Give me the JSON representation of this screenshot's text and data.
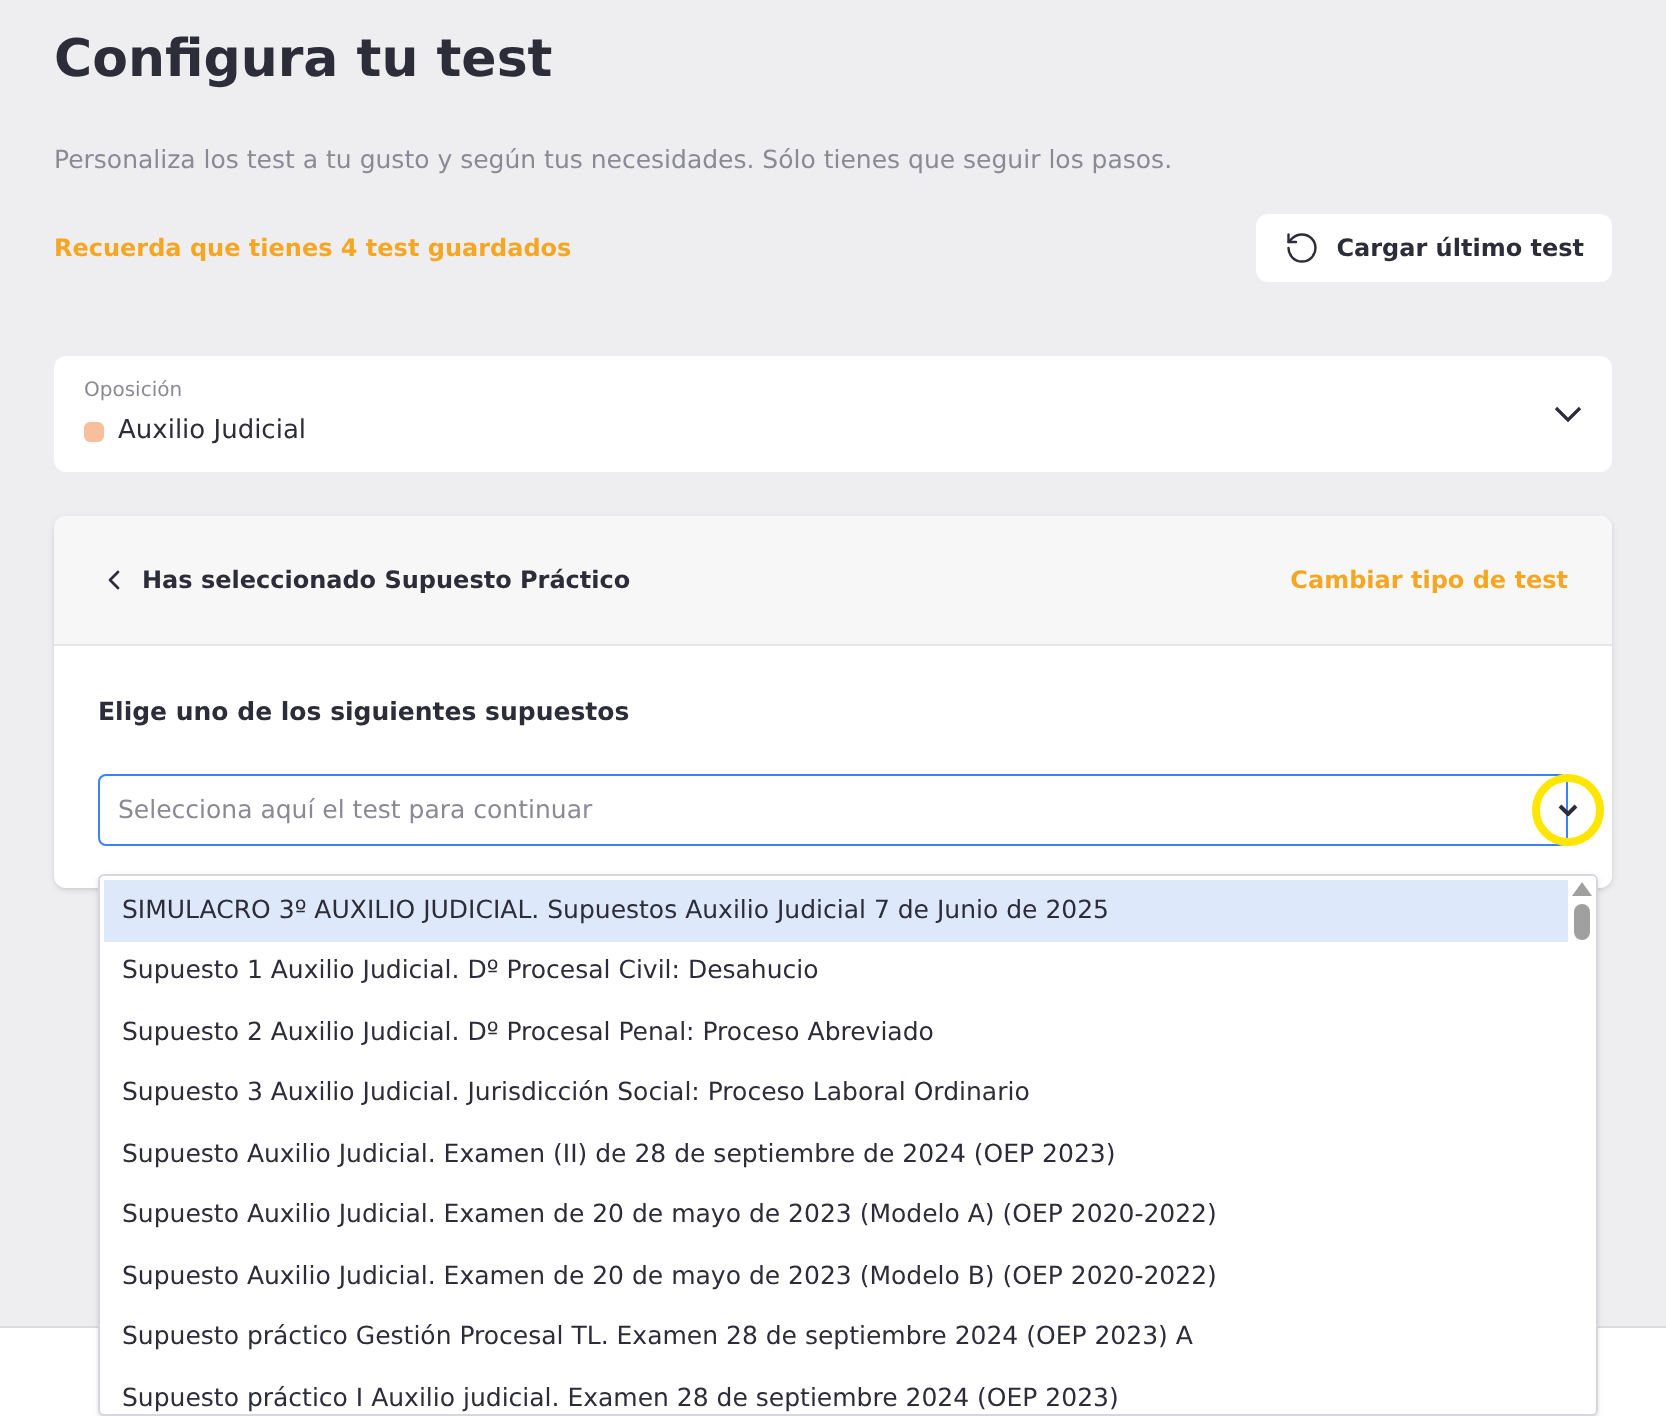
{
  "header": {
    "title": "Configura tu test",
    "subtitle": "Personaliza los test a tu gusto y según tus necesidades. Sólo tienes que seguir los pasos.",
    "saved_notice": "Recuerda que tienes 4 test guardados",
    "load_button": "Cargar último test"
  },
  "oposicion": {
    "label": "Oposición",
    "value": "Auxilio Judicial",
    "color": "#f8bf9c"
  },
  "panel": {
    "back_label": "Has seleccionado Supuesto Práctico",
    "change_link": "Cambiar tipo de test",
    "question": "Elige uno de los siguientes supuestos",
    "select": {
      "placeholder": "Selecciona aquí el test para continuar",
      "expanded": true
    },
    "options": [
      {
        "label": "SIMULACRO 3º AUXILIO JUDICIAL. Supuestos Auxilio Judicial 7 de Junio de 2025",
        "selected": true
      },
      {
        "label": "Supuesto 1 Auxilio Judicial. Dº Procesal Civil: Desahucio",
        "selected": false
      },
      {
        "label": "Supuesto 2 Auxilio Judicial. Dº Procesal Penal: Proceso Abreviado",
        "selected": false
      },
      {
        "label": "Supuesto 3 Auxilio Judicial. Jurisdicción Social: Proceso Laboral Ordinario",
        "selected": false
      },
      {
        "label": "Supuesto Auxilio Judicial. Examen (II) de 28 de septiembre de 2024 (OEP 2023)",
        "selected": false
      },
      {
        "label": "Supuesto Auxilio Judicial. Examen de 20 de mayo de 2023 (Modelo A) (OEP 2020-2022)",
        "selected": false
      },
      {
        "label": "Supuesto Auxilio Judicial. Examen de 20 de mayo de 2023 (Modelo B) (OEP 2020-2022)",
        "selected": false
      },
      {
        "label": "Supuesto práctico Gestión Procesal TL. Examen 28 de septiembre 2024 (OEP 2023) A",
        "selected": false
      },
      {
        "label": "Supuesto práctico I Auxilio judicial. Examen 28 de septiembre 2024 (OEP 2023)",
        "selected": false
      }
    ]
  }
}
